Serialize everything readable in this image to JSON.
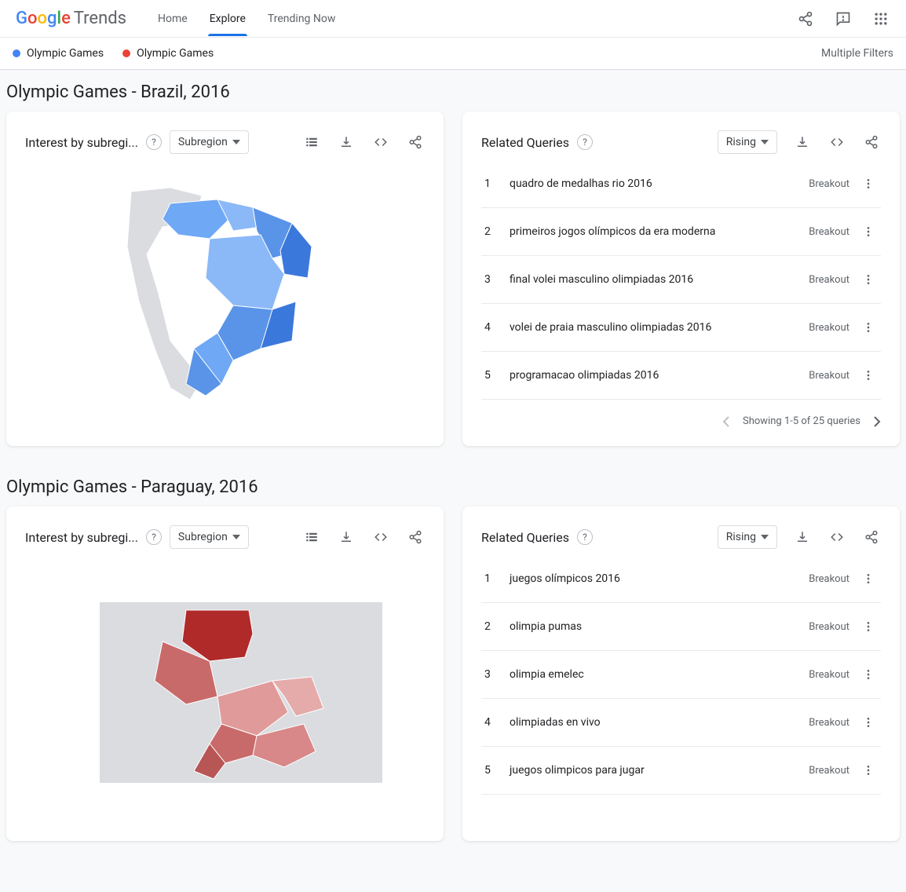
{
  "header": {
    "logo_trends": "Trends",
    "nav": {
      "home": "Home",
      "explore": "Explore",
      "trending": "Trending Now"
    }
  },
  "filter_bar": {
    "chip1": "Olympic Games",
    "chip2": "Olympic Games",
    "multi": "Multiple Filters"
  },
  "sections": {
    "s1": {
      "title": "Olympic Games - Brazil, 2016",
      "map_card": {
        "title": "Interest by subregi...",
        "select": "Subregion"
      },
      "queries_card": {
        "title": "Related Queries",
        "select": "Rising",
        "rows": [
          {
            "rank": "1",
            "text": "quadro de medalhas rio 2016",
            "score": "Breakout"
          },
          {
            "rank": "2",
            "text": "primeiros jogos olímpicos da era moderna",
            "score": "Breakout"
          },
          {
            "rank": "3",
            "text": "final volei masculino olimpiadas 2016",
            "score": "Breakout"
          },
          {
            "rank": "4",
            "text": "volei de praia masculino olimpiadas 2016",
            "score": "Breakout"
          },
          {
            "rank": "5",
            "text": "programacao olimpiadas 2016",
            "score": "Breakout"
          }
        ],
        "pager": "Showing 1-5 of 25 queries"
      }
    },
    "s2": {
      "title": "Olympic Games - Paraguay, 2016",
      "map_card": {
        "title": "Interest by subregi...",
        "select": "Subregion"
      },
      "queries_card": {
        "title": "Related Queries",
        "select": "Rising",
        "rows": [
          {
            "rank": "1",
            "text": "juegos olímpicos 2016",
            "score": "Breakout"
          },
          {
            "rank": "2",
            "text": "olimpia pumas",
            "score": "Breakout"
          },
          {
            "rank": "3",
            "text": "olimpia emelec",
            "score": "Breakout"
          },
          {
            "rank": "4",
            "text": "olimpiadas en vivo",
            "score": "Breakout"
          },
          {
            "rank": "5",
            "text": "juegos olimpicos para jugar",
            "score": "Breakout"
          }
        ]
      }
    }
  },
  "chart_data": [
    {
      "type": "map",
      "title": "Interest by subregion — Brazil",
      "region": "Brazil",
      "color_scale": "blue",
      "note": "Subregion-level interest; exact values not shown on screen"
    },
    {
      "type": "map",
      "title": "Interest by subregion — Paraguay",
      "region": "Paraguay",
      "color_scale": "red",
      "note": "Subregion-level interest; exact values not shown on screen"
    }
  ]
}
